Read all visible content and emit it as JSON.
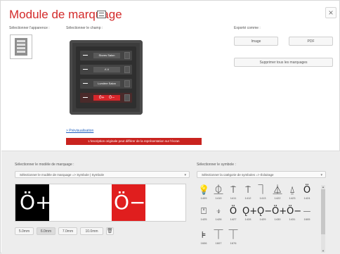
{
  "header": {
    "title": "Module de marquage",
    "close": "×"
  },
  "appearance": {
    "label": "Sélectionner l'apparence :"
  },
  "field": {
    "label": "Sélectionner le champ :"
  },
  "export": {
    "label": "Exporté comme :",
    "image": "Image",
    "pdf": "PDF",
    "delete_all": "Supprimer tous les marquages"
  },
  "device": {
    "rows": [
      {
        "text": "Stores Salon"
      },
      {
        "text": "Λ    V"
      },
      {
        "text": "Lumière Salon"
      },
      {
        "text": ""
      }
    ]
  },
  "preview": {
    "link": "> Prévisualisation",
    "warning": "L'inscription originale peut différer de la représentation sur l'écran"
  },
  "model": {
    "label": "Sélectionner le modèle de marquage :",
    "select": "Sélectionner le modèle de marquage => Symbole | Symbole",
    "sizes": [
      "5.0mm",
      "6.0mm",
      "7.0mm",
      "10.0mm"
    ],
    "selected_size": "6.0mm"
  },
  "symbol": {
    "label": "Sélectionner le symbole :",
    "select": "Sélectionner la catégorie de symboles => Éclairage",
    "items": [
      {
        "glyph": "💡",
        "num": "1409"
      },
      {
        "glyph": "⚗",
        "num": "1410"
      },
      {
        "glyph": "⚲",
        "num": "1411"
      },
      {
        "glyph": "⚲",
        "num": "1412"
      },
      {
        "glyph": "⚲",
        "num": "1413"
      },
      {
        "glyph": "⚲",
        "num": "1422"
      },
      {
        "glyph": "⚲",
        "num": "1423"
      },
      {
        "glyph": "⚲",
        "num": "1424"
      },
      {
        "glyph": "⚲",
        "num": "1425"
      },
      {
        "glyph": "⚲",
        "num": "1426"
      },
      {
        "glyph": "⚲",
        "num": "1427"
      },
      {
        "glyph": "⚲",
        "num": "1428"
      },
      {
        "glyph": "⚲",
        "num": "1429"
      },
      {
        "glyph": "⚲",
        "num": "1430"
      },
      {
        "glyph": "⚲",
        "num": "1431"
      },
      {
        "glyph": "⚲",
        "num": "1605"
      },
      {
        "glyph": "⚲",
        "num": "1606"
      },
      {
        "glyph": "⚲",
        "num": "1607"
      },
      {
        "glyph": "⚲",
        "num": "1676"
      }
    ]
  },
  "strip": {
    "left_symbol": "Ö+",
    "right_symbol": "Ö−"
  }
}
